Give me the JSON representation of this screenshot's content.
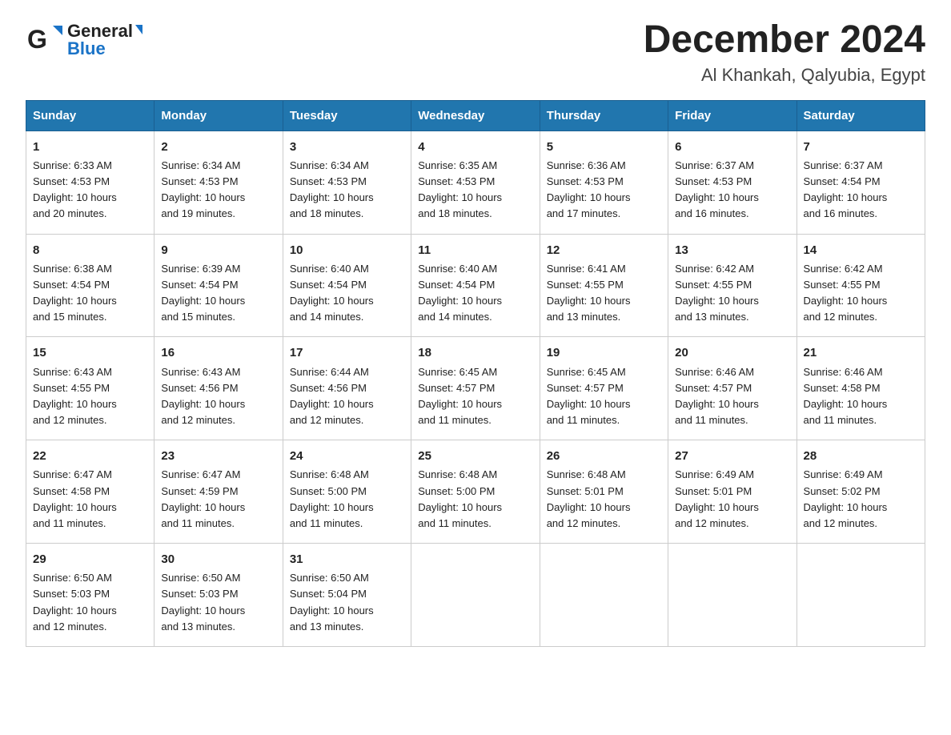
{
  "header": {
    "logo_general": "General",
    "logo_triangle": "▶",
    "logo_blue": "Blue",
    "main_title": "December 2024",
    "subtitle": "Al Khankah, Qalyubia, Egypt"
  },
  "days_of_week": [
    "Sunday",
    "Monday",
    "Tuesday",
    "Wednesday",
    "Thursday",
    "Friday",
    "Saturday"
  ],
  "weeks": [
    [
      {
        "day": "1",
        "sunrise": "6:33 AM",
        "sunset": "4:53 PM",
        "daylight": "10 hours and 20 minutes."
      },
      {
        "day": "2",
        "sunrise": "6:34 AM",
        "sunset": "4:53 PM",
        "daylight": "10 hours and 19 minutes."
      },
      {
        "day": "3",
        "sunrise": "6:34 AM",
        "sunset": "4:53 PM",
        "daylight": "10 hours and 18 minutes."
      },
      {
        "day": "4",
        "sunrise": "6:35 AM",
        "sunset": "4:53 PM",
        "daylight": "10 hours and 18 minutes."
      },
      {
        "day": "5",
        "sunrise": "6:36 AM",
        "sunset": "4:53 PM",
        "daylight": "10 hours and 17 minutes."
      },
      {
        "day": "6",
        "sunrise": "6:37 AM",
        "sunset": "4:53 PM",
        "daylight": "10 hours and 16 minutes."
      },
      {
        "day": "7",
        "sunrise": "6:37 AM",
        "sunset": "4:54 PM",
        "daylight": "10 hours and 16 minutes."
      }
    ],
    [
      {
        "day": "8",
        "sunrise": "6:38 AM",
        "sunset": "4:54 PM",
        "daylight": "10 hours and 15 minutes."
      },
      {
        "day": "9",
        "sunrise": "6:39 AM",
        "sunset": "4:54 PM",
        "daylight": "10 hours and 15 minutes."
      },
      {
        "day": "10",
        "sunrise": "6:40 AM",
        "sunset": "4:54 PM",
        "daylight": "10 hours and 14 minutes."
      },
      {
        "day": "11",
        "sunrise": "6:40 AM",
        "sunset": "4:54 PM",
        "daylight": "10 hours and 14 minutes."
      },
      {
        "day": "12",
        "sunrise": "6:41 AM",
        "sunset": "4:55 PM",
        "daylight": "10 hours and 13 minutes."
      },
      {
        "day": "13",
        "sunrise": "6:42 AM",
        "sunset": "4:55 PM",
        "daylight": "10 hours and 13 minutes."
      },
      {
        "day": "14",
        "sunrise": "6:42 AM",
        "sunset": "4:55 PM",
        "daylight": "10 hours and 12 minutes."
      }
    ],
    [
      {
        "day": "15",
        "sunrise": "6:43 AM",
        "sunset": "4:55 PM",
        "daylight": "10 hours and 12 minutes."
      },
      {
        "day": "16",
        "sunrise": "6:43 AM",
        "sunset": "4:56 PM",
        "daylight": "10 hours and 12 minutes."
      },
      {
        "day": "17",
        "sunrise": "6:44 AM",
        "sunset": "4:56 PM",
        "daylight": "10 hours and 12 minutes."
      },
      {
        "day": "18",
        "sunrise": "6:45 AM",
        "sunset": "4:57 PM",
        "daylight": "10 hours and 11 minutes."
      },
      {
        "day": "19",
        "sunrise": "6:45 AM",
        "sunset": "4:57 PM",
        "daylight": "10 hours and 11 minutes."
      },
      {
        "day": "20",
        "sunrise": "6:46 AM",
        "sunset": "4:57 PM",
        "daylight": "10 hours and 11 minutes."
      },
      {
        "day": "21",
        "sunrise": "6:46 AM",
        "sunset": "4:58 PM",
        "daylight": "10 hours and 11 minutes."
      }
    ],
    [
      {
        "day": "22",
        "sunrise": "6:47 AM",
        "sunset": "4:58 PM",
        "daylight": "10 hours and 11 minutes."
      },
      {
        "day": "23",
        "sunrise": "6:47 AM",
        "sunset": "4:59 PM",
        "daylight": "10 hours and 11 minutes."
      },
      {
        "day": "24",
        "sunrise": "6:48 AM",
        "sunset": "5:00 PM",
        "daylight": "10 hours and 11 minutes."
      },
      {
        "day": "25",
        "sunrise": "6:48 AM",
        "sunset": "5:00 PM",
        "daylight": "10 hours and 11 minutes."
      },
      {
        "day": "26",
        "sunrise": "6:48 AM",
        "sunset": "5:01 PM",
        "daylight": "10 hours and 12 minutes."
      },
      {
        "day": "27",
        "sunrise": "6:49 AM",
        "sunset": "5:01 PM",
        "daylight": "10 hours and 12 minutes."
      },
      {
        "day": "28",
        "sunrise": "6:49 AM",
        "sunset": "5:02 PM",
        "daylight": "10 hours and 12 minutes."
      }
    ],
    [
      {
        "day": "29",
        "sunrise": "6:50 AM",
        "sunset": "5:03 PM",
        "daylight": "10 hours and 12 minutes."
      },
      {
        "day": "30",
        "sunrise": "6:50 AM",
        "sunset": "5:03 PM",
        "daylight": "10 hours and 13 minutes."
      },
      {
        "day": "31",
        "sunrise": "6:50 AM",
        "sunset": "5:04 PM",
        "daylight": "10 hours and 13 minutes."
      },
      null,
      null,
      null,
      null
    ]
  ],
  "labels": {
    "sunrise": "Sunrise:",
    "sunset": "Sunset:",
    "daylight": "Daylight:"
  }
}
